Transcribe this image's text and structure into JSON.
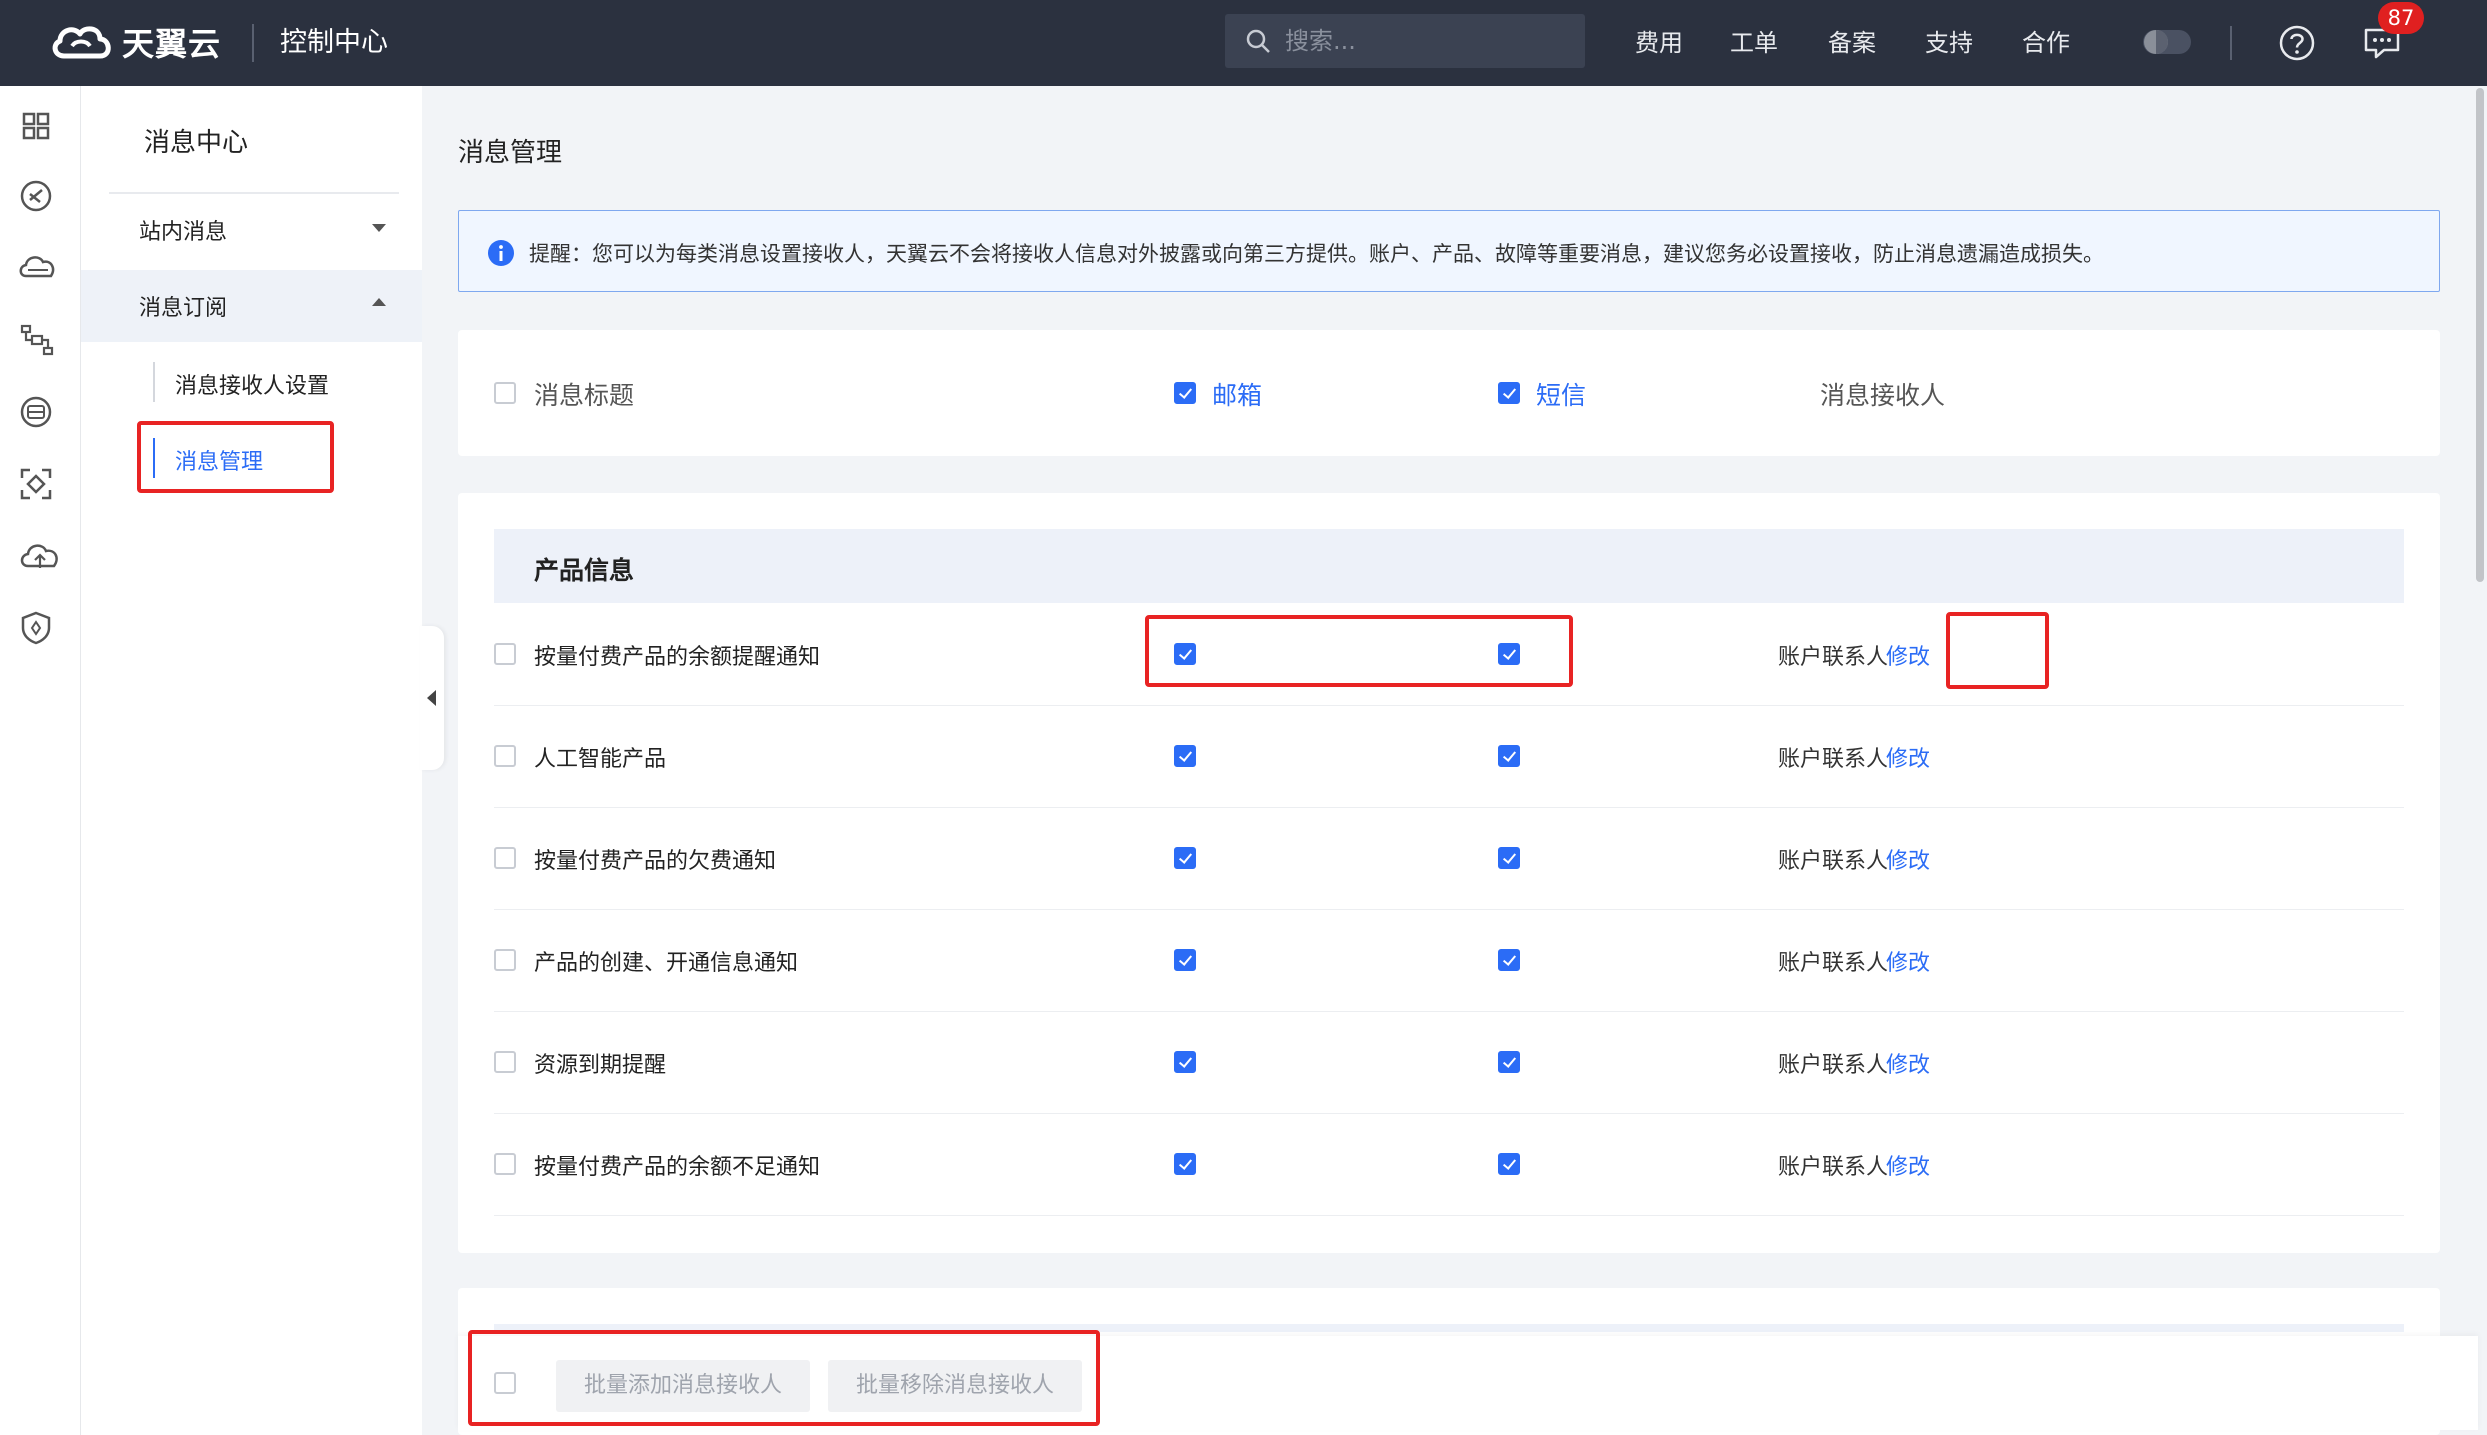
{
  "topbar": {
    "logo_text": "天翼云",
    "console_title": "控制中心",
    "search_placeholder": "搜索...",
    "links": [
      "费用",
      "工单",
      "备案",
      "支持",
      "合作"
    ],
    "message_badge": "87"
  },
  "sidebar": {
    "title": "消息中心",
    "groups": [
      {
        "label": "站内消息",
        "expanded": false
      },
      {
        "label": "消息订阅",
        "expanded": true
      }
    ],
    "sub_items": [
      {
        "label": "消息接收人设置"
      },
      {
        "label": "消息管理"
      }
    ]
  },
  "main": {
    "page_title": "消息管理",
    "notice": "提醒：您可以为每类消息设置接收人，天翼云不会将接收人信息对外披露或向第三方提供。账户、产品、故障等重要消息，建议您务必设置接收，防止消息遗漏造成损失。",
    "header": {
      "title_col": "消息标题",
      "email_col": "邮箱",
      "sms_col": "短信",
      "receiver_col": "消息接收人",
      "email_checked": true,
      "sms_checked": true
    },
    "section": {
      "title": "产品信息",
      "rows": [
        {
          "name": "按量付费产品的余额提醒通知",
          "email": true,
          "sms": true,
          "receiver": "账户联系人",
          "action": "修改"
        },
        {
          "name": "人工智能产品",
          "email": true,
          "sms": true,
          "receiver": "账户联系人",
          "action": "修改"
        },
        {
          "name": "按量付费产品的欠费通知",
          "email": true,
          "sms": true,
          "receiver": "账户联系人",
          "action": "修改"
        },
        {
          "name": "产品的创建、开通信息通知",
          "email": true,
          "sms": true,
          "receiver": "账户联系人",
          "action": "修改"
        },
        {
          "name": "资源到期提醒",
          "email": true,
          "sms": true,
          "receiver": "账户联系人",
          "action": "修改"
        },
        {
          "name": "按量付费产品的余额不足通知",
          "email": true,
          "sms": true,
          "receiver": "账户联系人",
          "action": "修改"
        }
      ]
    },
    "bulk": {
      "add_label": "批量添加消息接收人",
      "remove_label": "批量移除消息接收人"
    }
  },
  "colors": {
    "topbar_bg": "#2b313f",
    "accent": "#2b6cf6",
    "highlight": "#e82323",
    "badge": "#e02020"
  }
}
